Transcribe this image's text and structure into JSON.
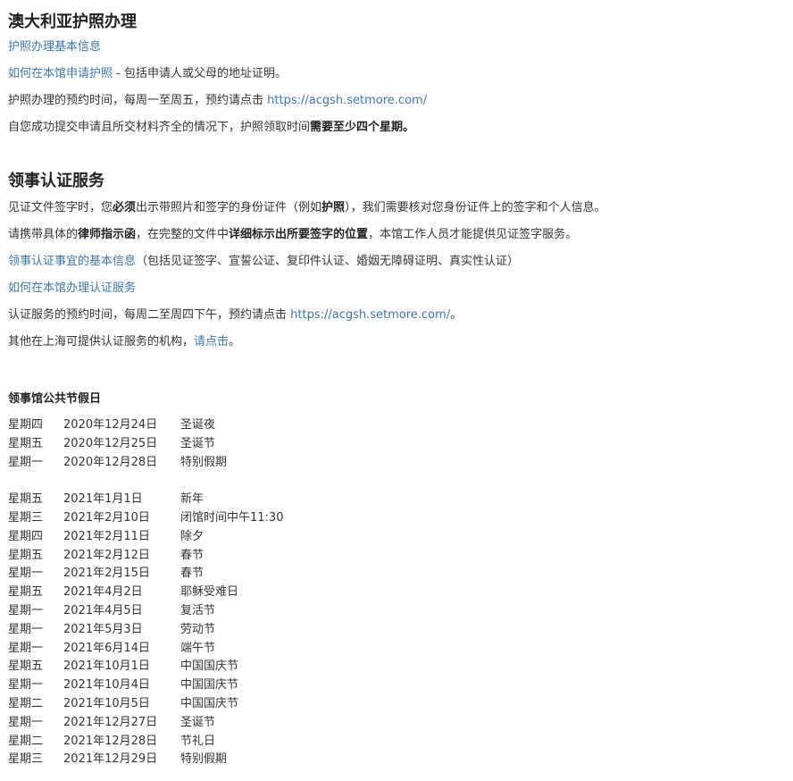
{
  "passport": {
    "title": "澳大利亚护照办理",
    "basic_info_link": "护照办理基本信息",
    "how_to_apply_link": "如何在本馆申请护照",
    "how_to_apply_suffix": " - 包括申请人或父母的地址证明。",
    "appointment_text": "护照办理的预约时间，每周一至周五，预约请点击 ",
    "appointment_link": "https://acgsh.setmore.com/",
    "processing_prefix": "自您成功提交申请且所交材料齐全的情况下，护照领取时间",
    "processing_bold": "需要至少四个星期。"
  },
  "notarial": {
    "title": "领事认证服务",
    "line1_a": "见证文件签字时，您",
    "line1_b": "必须",
    "line1_c": "出示带照片和签字的身份证件（例如",
    "line1_d": "护照",
    "line1_e": "），我们需要核对您身份证件上的签字和个人信息。",
    "line2_a": "请携带具体的",
    "line2_b": "律师指示函",
    "line2_c": "，在完整的文件中",
    "line2_d": "详细标示出所要签字的位置",
    "line2_e": "，本馆工作人员才能提供见证签字服务。",
    "info_link": "领事认证事宜的基本信息",
    "info_suffix": "（包括见证签字、宣誓公证、复印件认证、婚姻无障碍证明、真实性认证）",
    "how_link": "如何在本馆办理认证服务",
    "appointment_text": "认证服务的预约时间，每周二至周四下午，预约请点击 ",
    "appointment_link": "https://acgsh.setmore.com/",
    "appointment_suffix": "。",
    "other_text": "其他在上海可提供认证服务的机构，",
    "other_link": "请点击",
    "other_suffix": "。"
  },
  "holidays": {
    "title": "领事馆公共节假日",
    "group_2020": [
      {
        "day": "星期四",
        "date": "2020年12月24日",
        "name": "圣诞夜"
      },
      {
        "day": "星期五",
        "date": "2020年12月25日",
        "name": "圣诞节"
      },
      {
        "day": "星期一",
        "date": "2020年12月28日",
        "name": "特别假期"
      }
    ],
    "group_2021": [
      {
        "day": "星期五",
        "date": "2021年1月1日",
        "name": "新年"
      },
      {
        "day": "星期三",
        "date": "2021年2月10日",
        "name": "闭馆时间中午11:30"
      },
      {
        "day": "星期四",
        "date": "2021年2月11日",
        "name": "除夕"
      },
      {
        "day": "星期五",
        "date": "2021年2月12日",
        "name": "春节"
      },
      {
        "day": "星期一",
        "date": "2021年2月15日",
        "name": "春节"
      },
      {
        "day": "星期五",
        "date": "2021年4月2日",
        "name": "耶稣受难日"
      },
      {
        "day": "星期一",
        "date": "2021年4月5日",
        "name": "复活节"
      },
      {
        "day": "星期一",
        "date": "2021年5月3日",
        "name": "劳动节"
      },
      {
        "day": "星期一",
        "date": "2021年6月14日",
        "name": "端午节"
      },
      {
        "day": "星期五",
        "date": "2021年10月1日",
        "name": "中国国庆节"
      },
      {
        "day": "星期一",
        "date": "2021年10月4日",
        "name": "中国国庆节"
      },
      {
        "day": "星期二",
        "date": "2021年10月5日",
        "name": "中国国庆节"
      },
      {
        "day": "星期一",
        "date": "2021年12月27日",
        "name": "圣诞节"
      },
      {
        "day": "星期二",
        "date": "2021年12月28日",
        "name": "节礼日"
      },
      {
        "day": "星期三",
        "date": "2021年12月29日",
        "name": "特别假期"
      }
    ]
  },
  "colors": {
    "link": "#3a78a8",
    "text": "#333333",
    "heading": "#222222"
  }
}
